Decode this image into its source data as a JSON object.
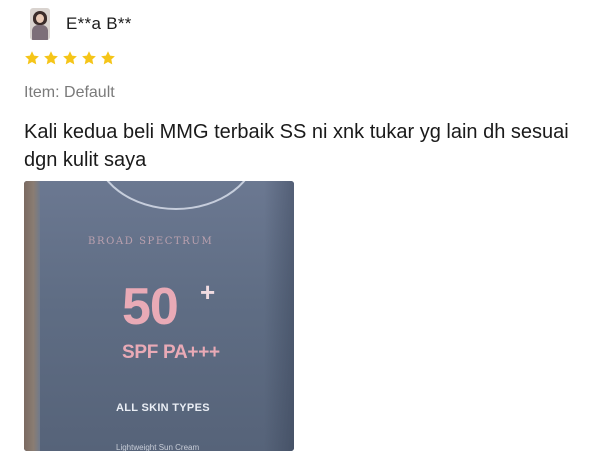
{
  "review": {
    "username": "E**a B**",
    "avatar_icon": "user-avatar-photo",
    "rating": 5,
    "rating_max": 5,
    "star_color": "#f5c518",
    "item_variant": "Item: Default",
    "text": "Kali kedua beli MMG terbaik SS ni xnk tukar yg lain dh sesuai dgn kulit saya",
    "photo": {
      "broad_spectrum": "BROAD SPECTRUM",
      "spf_number": "50",
      "spf_plus": "+",
      "spf_pa": "SPF PA+++",
      "skin_types": "ALL SKIN TYPES",
      "footer": "Lightweight Sun Cream"
    }
  }
}
